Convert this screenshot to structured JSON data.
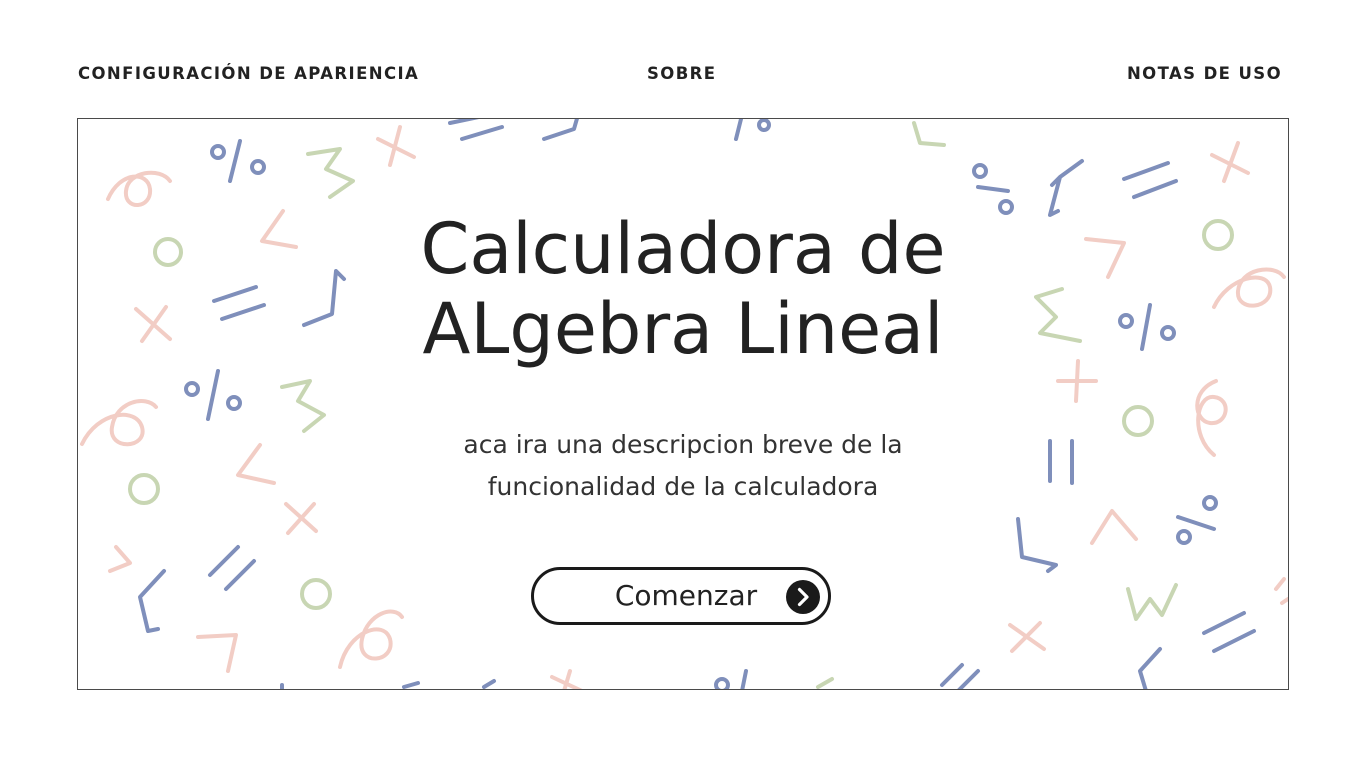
{
  "nav": {
    "appearance": "CONFIGURACIÓN DE APARIENCIA",
    "about": "SOBRE",
    "usage_notes": "NOTAS DE USO"
  },
  "hero": {
    "title_line1": "Calculadora de",
    "title_line2": "ALgebra Lineal",
    "description_line1": "aca ira una descripcion breve de la",
    "description_line2": "funcionalidad de la calculadora",
    "start_button": "Comenzar"
  },
  "decor_palette": {
    "blue": "#7f8fbb",
    "pink": "#f2cdc5",
    "green": "#c8d6b3"
  }
}
